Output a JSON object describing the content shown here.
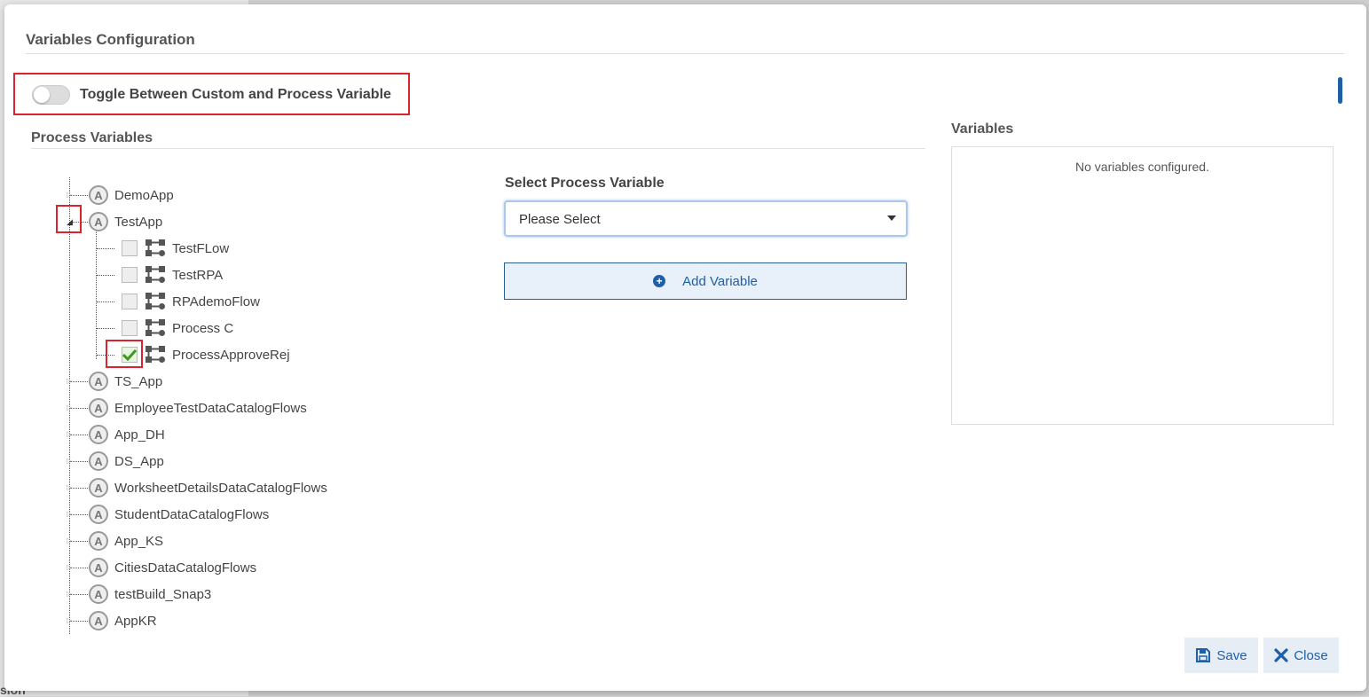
{
  "background": {
    "partial_text": "sion"
  },
  "modal": {
    "title": "Variables Configuration",
    "toggle": {
      "label": "Toggle Between Custom and Process Variable",
      "state": "off"
    },
    "process_variables": {
      "title": "Process Variables",
      "tree": [
        {
          "label": "DemoApp",
          "type": "app",
          "expanded": false
        },
        {
          "label": "TestApp",
          "type": "app",
          "expanded": true,
          "children": [
            {
              "label": "TestFLow",
              "type": "flow",
              "checked": false
            },
            {
              "label": "TestRPA",
              "type": "flow",
              "checked": false
            },
            {
              "label": "RPAdemoFlow",
              "type": "flow",
              "checked": false
            },
            {
              "label": "Process C",
              "type": "flow",
              "checked": false
            },
            {
              "label": "ProcessApproveRej",
              "type": "flow",
              "checked": true
            }
          ]
        },
        {
          "label": "TS_App",
          "type": "app",
          "expanded": false
        },
        {
          "label": "EmployeeTestDataCatalogFlows",
          "type": "app",
          "expanded": false
        },
        {
          "label": "App_DH",
          "type": "app",
          "expanded": false
        },
        {
          "label": "DS_App",
          "type": "app",
          "expanded": false
        },
        {
          "label": "WorksheetDetailsDataCatalogFlows",
          "type": "app",
          "expanded": false
        },
        {
          "label": "StudentDataCatalogFlows",
          "type": "app",
          "expanded": false
        },
        {
          "label": "App_KS",
          "type": "app",
          "expanded": false
        },
        {
          "label": "CitiesDataCatalogFlows",
          "type": "app",
          "expanded": false
        },
        {
          "label": "testBuild_Snap3",
          "type": "app",
          "expanded": false
        },
        {
          "label": "AppKR",
          "type": "app",
          "expanded": false
        }
      ]
    },
    "select_process_variable": {
      "label": "Select Process Variable",
      "selected": "Please Select"
    },
    "add_variable_label": "Add Variable",
    "variables": {
      "title": "Variables",
      "empty_text": "No variables configured."
    },
    "footer": {
      "save_label": "Save",
      "close_label": "Close"
    }
  },
  "colors": {
    "accent": "#1f5fa8",
    "highlight_red": "#d9232e",
    "check_green": "#3a9a1e"
  }
}
